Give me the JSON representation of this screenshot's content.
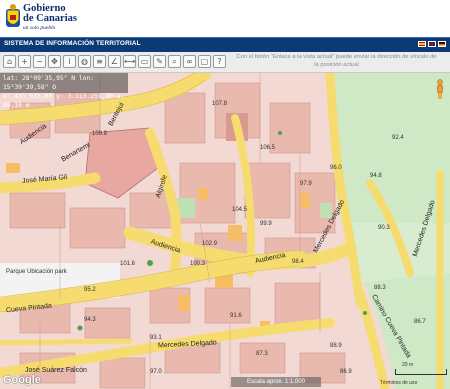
{
  "header": {
    "brand_line1": "Gobierno",
    "brand_line2": "de Canarias",
    "motto": "un solo pueblo"
  },
  "titlebar": {
    "title": "SISTEMA DE INFORMACIÓN TERRITORIAL",
    "flags": [
      "es",
      "uk",
      "de"
    ]
  },
  "toolbar": {
    "tools": [
      "home-icon",
      "zoom-in-icon",
      "zoom-out-icon",
      "pan-icon",
      "info-icon",
      "globe-icon",
      "layers-icon",
      "measure-icon",
      "ruler-icon",
      "print-icon",
      "edit-icon",
      "search-icon",
      "link-icon",
      "window-icon",
      "help-icon"
    ],
    "hint": "Con el botón \"Enlace a la vista actual\" puede enviar la dirección de vínculo de la posición actual"
  },
  "coords": {
    "line1": "lat: 28°09'35,95\" N   lon: 15°39'39,58\" O",
    "line2": "x: 435.933,09  y: 3.113.251,90  a: 89,10 m"
  },
  "map": {
    "streets": [
      {
        "text": "Audiencia",
        "key": "s1"
      },
      {
        "text": "Benartemi",
        "key": "s2"
      },
      {
        "text": "Bentejui",
        "key": "s3"
      },
      {
        "text": "Algirofe",
        "key": "s4"
      },
      {
        "text": "José María Gil",
        "key": "s5"
      },
      {
        "text": "Audiencia",
        "key": "s6"
      },
      {
        "text": "Audiencia",
        "key": "s7"
      },
      {
        "text": "Cueva Pintada",
        "key": "s8"
      },
      {
        "text": "Mercedes Delgado",
        "key": "s9"
      },
      {
        "text": "Mercedes Delgado",
        "key": "s10"
      },
      {
        "text": "Camino Cueva Pintada",
        "key": "s11"
      },
      {
        "text": "José Suárez Falcón",
        "key": "s12"
      },
      {
        "text": "Mercedes Delgado",
        "key": "s13"
      }
    ],
    "park_label": "Parque Ubicación park",
    "elevations": [
      "109.8",
      "107.8",
      "106.5",
      "104.5",
      "102.9",
      "101.6",
      "100.3",
      "99.9",
      "98.4",
      "97.9",
      "96.0",
      "94.8",
      "92.4",
      "90.3",
      "88.3",
      "86.7",
      "95.2",
      "94.3",
      "93.1",
      "91.6",
      "87.3",
      "88.9",
      "86.9",
      "97.0"
    ]
  },
  "footer": {
    "google": "Google",
    "scale": "Escala aprox. 1:1.000",
    "terms": "Términos de uso",
    "scale_unit": "20 m"
  }
}
